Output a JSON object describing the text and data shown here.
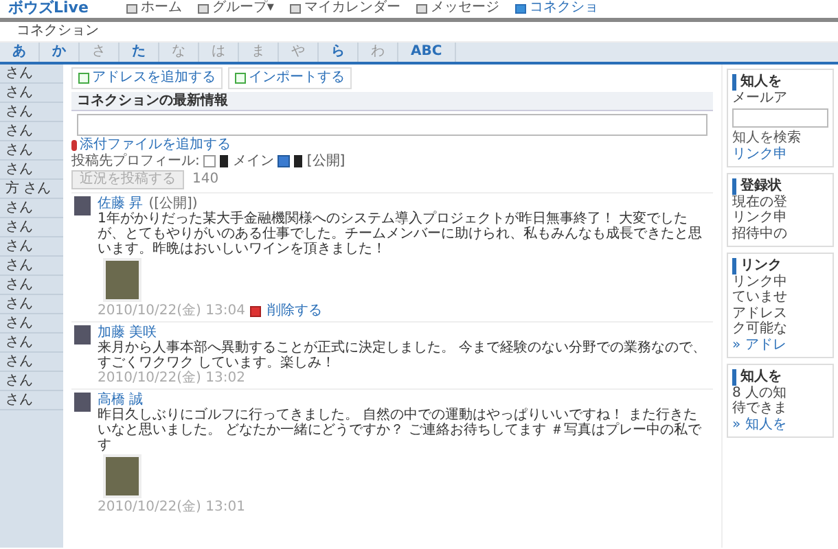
{
  "header": {
    "logo": "ボウズLive",
    "nav": [
      {
        "label": "ホーム",
        "selected": false
      },
      {
        "label": "グループ▾",
        "selected": false
      },
      {
        "label": "マイカレンダー",
        "selected": false
      },
      {
        "label": "メッセージ",
        "selected": false
      },
      {
        "label": "コネクショ",
        "selected": true
      }
    ]
  },
  "breadcrumb": "コネクション",
  "index_tabs": [
    {
      "label": "あ",
      "has_entries": true
    },
    {
      "label": "か",
      "has_entries": true
    },
    {
      "label": "さ",
      "has_entries": false
    },
    {
      "label": "た",
      "has_entries": true
    },
    {
      "label": "な",
      "has_entries": false
    },
    {
      "label": "は",
      "has_entries": false
    },
    {
      "label": "ま",
      "has_entries": false
    },
    {
      "label": "や",
      "has_entries": false
    },
    {
      "label": "ら",
      "has_entries": true
    },
    {
      "label": "わ",
      "has_entries": false
    },
    {
      "label": "ABC",
      "has_entries": true
    }
  ],
  "sidebar": {
    "items": [
      "さん",
      "さん",
      "さん",
      "さん",
      "さん",
      "さん",
      "方 さん",
      "さん",
      "さん",
      "さん",
      "さん",
      "さん",
      "さん",
      "さん",
      "さん",
      "さん",
      "さん",
      "さん"
    ]
  },
  "main": {
    "actions": [
      "アドレスを追加する",
      "インポートする"
    ],
    "heading": "コネクションの最新情報",
    "attach_link": "添付ファイルを追加する",
    "profile": {
      "label": "投稿先プロフィール:",
      "options": [
        {
          "label": "メイン",
          "checked": false
        },
        {
          "label": "[公開]",
          "checked": true
        }
      ]
    },
    "post_button": {
      "label": "近況を投稿する",
      "disabled": true
    },
    "char_count": "140",
    "posts": [
      {
        "author": "佐藤 昇",
        "visibility": "([公開])",
        "text": "1年がかりだった某大手金融機関様へのシステム導入プロジェクトが昨日無事終了！ 大変でしたが、とてもやりがいのある仕事でした。チームメンバーに助けられ、私もみんなも成長できたと思います。昨晩はおいしいワインを頂きました！",
        "has_photo": true,
        "date": "2010/10/22(金) 13:04",
        "delete": "削除する"
      },
      {
        "author": "加藤 美咲",
        "text": "来月から人事本部へ異動することが正式に決定しました。 今まで経験のない分野での業務なので、すごくワクワク しています。楽しみ！",
        "has_photo": false,
        "date": "2010/10/22(金) 13:02"
      },
      {
        "author": "高橋 誠",
        "text": "昨日久しぶりにゴルフに行ってきました。 自然の中での運動はやっぱりいいですね！ また行きたいなと思いました。 どなたか一緒にどうですか？ ご連絡お待ちしてます ＃写真はプレー中の私です",
        "has_photo": true,
        "date": "2010/10/22(金) 13:01"
      }
    ]
  },
  "right": {
    "boxes": [
      {
        "title": "知人を",
        "lines": [
          "メールア"
        ],
        "field": true,
        "small": "知人を検索",
        "link": "リンク申"
      },
      {
        "title": "登録状",
        "lines": [
          "現在の登",
          "リンク申",
          "招待中の"
        ],
        "field": false
      },
      {
        "title": "リンク",
        "lines": [
          "リンク中",
          "ていませ",
          "アドレス",
          "ク可能な"
        ],
        "field": false,
        "link": "» アドレ"
      },
      {
        "title": "知人を",
        "lines": [
          "8 人の知",
          "待できま"
        ],
        "field": false,
        "link": "» 知人を"
      }
    ]
  }
}
